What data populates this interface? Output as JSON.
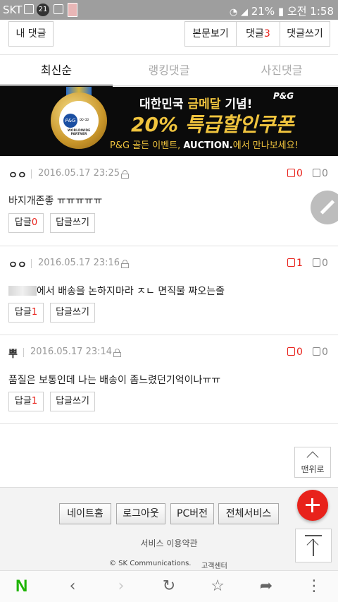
{
  "status_bar": {
    "carrier": "SKT",
    "notification_count": "21",
    "battery": "21%",
    "time_label": "오전 1:58"
  },
  "top_buttons": {
    "my_comments": "내 댓글",
    "view_article": "본문보기",
    "comments_label": "댓글",
    "comments_count": "3",
    "write_comment": "댓글쓰기"
  },
  "tabs": [
    {
      "label": "최신순",
      "active": true
    },
    {
      "label": "랭킹댓글",
      "active": false
    },
    {
      "label": "사진댓글",
      "active": false
    }
  ],
  "banner": {
    "line1_a": "대한민국 ",
    "line1_gold": "금메달",
    "line1_b": " 기념!",
    "line2": "20% 특급할인쿠폰",
    "line3_a": "P&G 골든 이벤트, ",
    "line3_brand": "AUCTION.",
    "line3_b": "에서 만나보세요!",
    "brand": "P&G",
    "medal_logo": "P&G",
    "medal_caption": "WORLDWIDE PARTNER"
  },
  "comments": [
    {
      "author": "ㅇㅇ",
      "date": "2016.05.17 23:25",
      "likes": "0",
      "dislikes": "0",
      "text": "바지개존좋 ㅠㅠㅠㅠㅠ",
      "reply_label": "답글",
      "reply_count": "0",
      "write_reply": "답글쓰기"
    },
    {
      "author": "ㅇㅇ",
      "date": "2016.05.17 23:16",
      "likes": "1",
      "dislikes": "0",
      "text": "에서 배송을 논하지마라 ㅈㄴ 면직물 짜오는줄",
      "reply_label": "답글",
      "reply_count": "1",
      "write_reply": "답글쓰기"
    },
    {
      "author": "뿌",
      "date": "2016.05.17 23:14",
      "likes": "0",
      "dislikes": "0",
      "text": "품질은 보통인데 나는 배송이 좀느렸던기억이나ㅠㅠ",
      "reply_label": "답글",
      "reply_count": "1",
      "write_reply": "답글쓰기"
    }
  ],
  "to_top_label": "맨위로",
  "footer": {
    "buttons": [
      "네이트홈",
      "로그아웃",
      "PC버전",
      "전체서비스"
    ],
    "terms": "서비스 이용약관",
    "copyright": "© SK Communications.",
    "support": "고객센터"
  },
  "bottom_nav": {
    "naver_logo": "N"
  },
  "colors": {
    "accent_red": "#e8221b",
    "naver_green": "#1db400"
  }
}
